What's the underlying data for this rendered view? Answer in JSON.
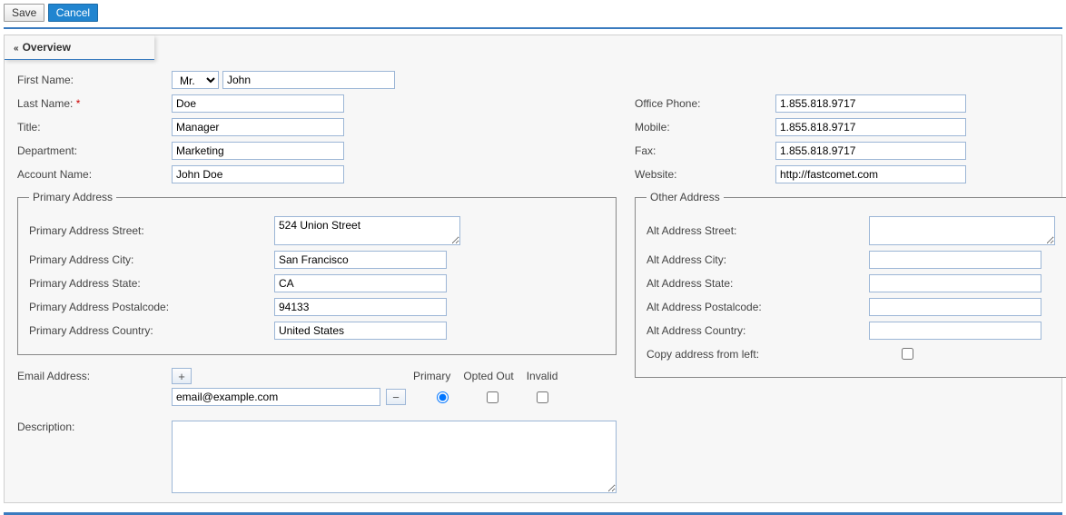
{
  "toolbar": {
    "save": "Save",
    "cancel": "Cancel"
  },
  "section": {
    "overview": "Overview"
  },
  "labels": {
    "first_name": "First Name:",
    "last_name": "Last Name:",
    "title": "Title:",
    "department": "Department:",
    "account_name": "Account Name:",
    "office_phone": "Office Phone:",
    "mobile": "Mobile:",
    "fax": "Fax:",
    "website": "Website:",
    "primary_address": "Primary Address",
    "p_street": "Primary Address Street:",
    "p_city": "Primary Address City:",
    "p_state": "Primary Address State:",
    "p_postal": "Primary Address Postalcode:",
    "p_country": "Primary Address Country:",
    "other_address": "Other Address",
    "a_street": "Alt Address Street:",
    "a_city": "Alt Address City:",
    "a_state": "Alt Address State:",
    "a_postal": "Alt Address Postalcode:",
    "a_country": "Alt Address Country:",
    "copy_left": "Copy address from left:",
    "email": "Email Address:",
    "email_primary": "Primary",
    "email_opted": "Opted Out",
    "email_invalid": "Invalid",
    "description": "Description:"
  },
  "values": {
    "salutation": "Mr.",
    "first_name": "John",
    "last_name": "Doe",
    "title": "Manager",
    "department": "Marketing",
    "account_name": "John Doe",
    "office_phone": "1.855.818.9717",
    "mobile": "1.855.818.9717",
    "fax": "1.855.818.9717",
    "website": "http://fastcomet.com",
    "p_street": "524 Union Street",
    "p_city": "San Francisco",
    "p_state": "CA",
    "p_postal": "94133",
    "p_country": "United States",
    "a_street": "",
    "a_city": "",
    "a_state": "",
    "a_postal": "",
    "a_country": "",
    "email0": "email@example.com",
    "description": ""
  }
}
